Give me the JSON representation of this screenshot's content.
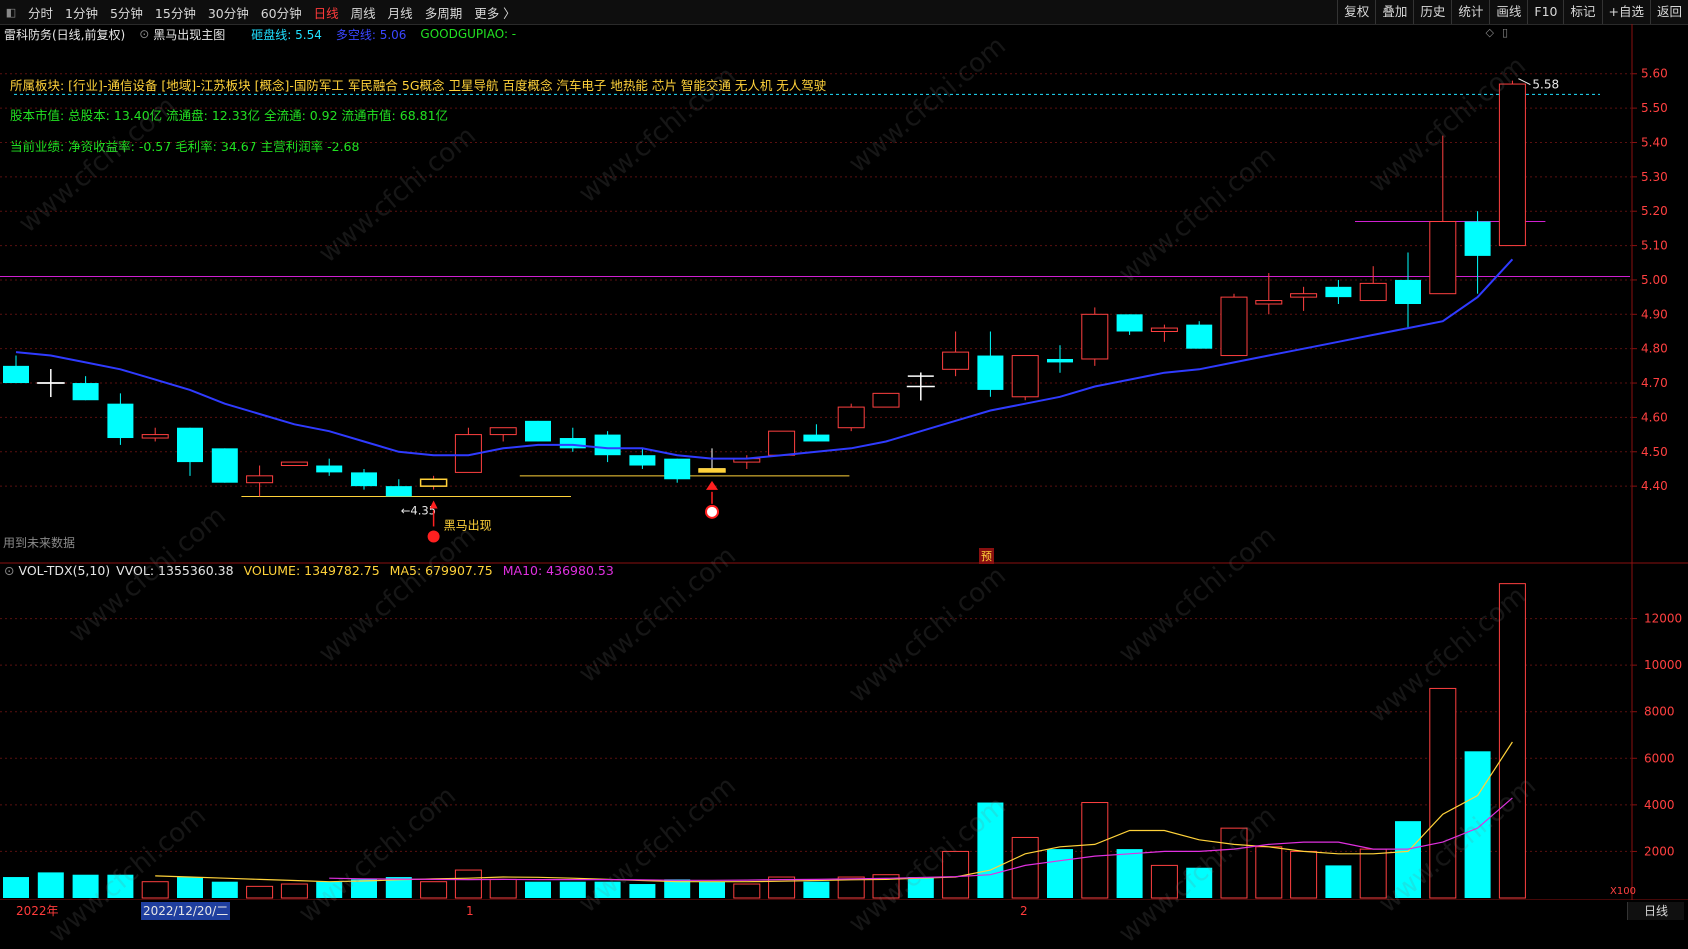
{
  "topbar": {
    "collapse_icon": "collapse-panel-icon",
    "periods": [
      "分时",
      "1分钟",
      "5分钟",
      "15分钟",
      "30分钟",
      "60分钟",
      "日线",
      "周线",
      "月线",
      "多周期",
      "更多 〉"
    ],
    "active_period": "日线",
    "tools": [
      "复权",
      "叠加",
      "历史",
      "统计",
      "画线",
      "F10",
      "标记",
      "+自选",
      "返回"
    ]
  },
  "info": {
    "stock_title": "雷科防务(日线,前复权)",
    "indicator_name": "黑马出现主图",
    "hard_line": "砸盘线: 5.54",
    "long_short": "多空线: 5.06",
    "goodgupiao": "GOODGUPIAO: -",
    "colors": {
      "hard": "#20e0ff",
      "longshort": "#2f3bff",
      "good": "#22e022"
    }
  },
  "info_lines": {
    "sectors": "所属板块: [行业]-通信设备 [地域]-江苏板块 [概念]-国防军工 军民融合 5G概念 卫星导航 百度概念 汽车电子 地热能 芯片 智能交通 无人机 无人驾驶",
    "market_cap": "股本市值: 总股本: 13.40亿 流通盘: 12.33亿 全流通: 0.92 流通市值: 68.81亿",
    "performance": "当前业绩: 净资收益率: -0.57 毛利率: 34.67 主营利润率 -2.68"
  },
  "annotations": {
    "low_label": "←4.35",
    "dark_horse": "黑马出现",
    "high_label": "5.58",
    "future_data": "用到未来数据",
    "yu": "预"
  },
  "volume_header": {
    "name": "VOL-TDX(5,10)",
    "vvol": "VVOL: 1355360.38",
    "volume": "VOLUME: 1349782.75",
    "ma5": "MA5: 679907.75",
    "ma10": "MA10: 436980.53",
    "unit": "X100"
  },
  "bottom": {
    "year": "2022年",
    "cursor_date": "2022/12/20/二",
    "month1": "1",
    "month2": "2",
    "period_label": "日线"
  },
  "watermark": "www.cfchi.com",
  "chart_data": [
    {
      "type": "candlestick",
      "title": "雷科防务(日线,前复权)",
      "y_ticks": [
        4.4,
        4.5,
        4.6,
        4.7,
        4.8,
        4.9,
        5.0,
        5.1,
        5.2,
        5.3,
        5.4,
        5.5,
        5.6
      ],
      "ylim": [
        4.22,
        5.64
      ],
      "candles": [
        {
          "o": 4.75,
          "h": 4.78,
          "l": 4.7,
          "c": 4.7,
          "v": 900
        },
        {
          "o": 4.7,
          "h": 4.71,
          "l": 4.7,
          "c": 4.7,
          "v": 1100,
          "cross": true
        },
        {
          "o": 4.7,
          "h": 4.72,
          "l": 4.65,
          "c": 4.65,
          "v": 1000
        },
        {
          "o": 4.64,
          "h": 4.67,
          "l": 4.52,
          "c": 4.54,
          "v": 1000
        },
        {
          "o": 4.54,
          "h": 4.57,
          "l": 4.53,
          "c": 4.55,
          "v": 700
        },
        {
          "o": 4.57,
          "h": 4.57,
          "l": 4.43,
          "c": 4.47,
          "v": 900
        },
        {
          "o": 4.51,
          "h": 4.51,
          "l": 4.41,
          "c": 4.41,
          "v": 700
        },
        {
          "o": 4.41,
          "h": 4.46,
          "l": 4.37,
          "c": 4.43,
          "v": 500
        },
        {
          "o": 4.46,
          "h": 4.47,
          "l": 4.46,
          "c": 4.47,
          "v": 600
        },
        {
          "o": 4.46,
          "h": 4.48,
          "l": 4.43,
          "c": 4.44,
          "v": 700
        },
        {
          "o": 4.44,
          "h": 4.45,
          "l": 4.39,
          "c": 4.4,
          "v": 800
        },
        {
          "o": 4.4,
          "h": 4.42,
          "l": 4.37,
          "c": 4.37,
          "v": 900
        },
        {
          "o": 4.4,
          "h": 4.43,
          "l": 4.39,
          "c": 4.42,
          "v": 700
        },
        {
          "o": 4.44,
          "h": 4.57,
          "l": 4.44,
          "c": 4.55,
          "v": 1200
        },
        {
          "o": 4.55,
          "h": 4.57,
          "l": 4.53,
          "c": 4.57,
          "v": 800
        },
        {
          "o": 4.59,
          "h": 4.59,
          "l": 4.53,
          "c": 4.53,
          "v": 700
        },
        {
          "o": 4.54,
          "h": 4.57,
          "l": 4.5,
          "c": 4.51,
          "v": 700
        },
        {
          "o": 4.55,
          "h": 4.56,
          "l": 4.47,
          "c": 4.49,
          "v": 700
        },
        {
          "o": 4.49,
          "h": 4.51,
          "l": 4.45,
          "c": 4.46,
          "v": 600
        },
        {
          "o": 4.48,
          "h": 4.48,
          "l": 4.41,
          "c": 4.42,
          "v": 800
        },
        {
          "o": 4.45,
          "h": 4.51,
          "l": 4.44,
          "c": 4.45,
          "v": 700
        },
        {
          "o": 4.47,
          "h": 4.49,
          "l": 4.45,
          "c": 4.48,
          "v": 600
        },
        {
          "o": 4.49,
          "h": 4.56,
          "l": 4.49,
          "c": 4.56,
          "v": 900
        },
        {
          "o": 4.55,
          "h": 4.58,
          "l": 4.53,
          "c": 4.53,
          "v": 700
        },
        {
          "o": 4.57,
          "h": 4.64,
          "l": 4.56,
          "c": 4.63,
          "v": 900
        },
        {
          "o": 4.63,
          "h": 4.67,
          "l": 4.63,
          "c": 4.67,
          "v": 1000
        },
        {
          "o": 4.72,
          "h": 4.72,
          "l": 4.72,
          "c": 4.72,
          "v": 900
        },
        {
          "o": 4.74,
          "h": 4.85,
          "l": 4.72,
          "c": 4.79,
          "v": 2000
        },
        {
          "o": 4.78,
          "h": 4.85,
          "l": 4.66,
          "c": 4.68,
          "v": 4100
        },
        {
          "o": 4.66,
          "h": 4.78,
          "l": 4.65,
          "c": 4.78,
          "v": 2600
        },
        {
          "o": 4.77,
          "h": 4.81,
          "l": 4.73,
          "c": 4.76,
          "v": 2100
        },
        {
          "o": 4.77,
          "h": 4.92,
          "l": 4.75,
          "c": 4.9,
          "v": 4100
        },
        {
          "o": 4.9,
          "h": 4.9,
          "l": 4.84,
          "c": 4.85,
          "v": 2100
        },
        {
          "o": 4.85,
          "h": 4.87,
          "l": 4.82,
          "c": 4.86,
          "v": 1400
        },
        {
          "o": 4.87,
          "h": 4.88,
          "l": 4.8,
          "c": 4.8,
          "v": 1300
        },
        {
          "o": 4.78,
          "h": 4.96,
          "l": 4.78,
          "c": 4.95,
          "v": 3000
        },
        {
          "o": 4.93,
          "h": 5.02,
          "l": 4.9,
          "c": 4.94,
          "v": 2200
        },
        {
          "o": 4.95,
          "h": 4.98,
          "l": 4.91,
          "c": 4.96,
          "v": 2000
        },
        {
          "o": 4.98,
          "h": 5.0,
          "l": 4.93,
          "c": 4.95,
          "v": 1400
        },
        {
          "o": 4.94,
          "h": 5.04,
          "l": 4.94,
          "c": 4.99,
          "v": 2100
        },
        {
          "o": 5.0,
          "h": 5.08,
          "l": 4.86,
          "c": 4.93,
          "v": 3300
        },
        {
          "o": 4.96,
          "h": 5.42,
          "l": 4.96,
          "c": 5.17,
          "v": 9000
        },
        {
          "o": 5.17,
          "h": 5.2,
          "l": 4.96,
          "c": 5.07,
          "v": 6300
        },
        {
          "o": 5.1,
          "h": 5.58,
          "l": 5.1,
          "c": 5.57,
          "v": 13500
        }
      ],
      "ma_line": [
        4.79,
        4.78,
        4.76,
        4.74,
        4.71,
        4.68,
        4.64,
        4.61,
        4.58,
        4.56,
        4.53,
        4.5,
        4.49,
        4.49,
        4.51,
        4.52,
        4.52,
        4.51,
        4.51,
        4.49,
        4.48,
        4.48,
        4.49,
        4.5,
        4.51,
        4.53,
        4.56,
        4.59,
        4.62,
        4.64,
        4.66,
        4.69,
        4.71,
        4.73,
        4.74,
        4.76,
        4.78,
        4.8,
        4.82,
        4.84,
        4.86,
        4.88,
        4.95,
        5.06
      ],
      "hlines": [
        {
          "value": 5.01,
          "color": "#d020d0"
        },
        {
          "value": 5.54,
          "color": "#20e0ff",
          "dashed": true
        }
      ],
      "support_lines": [
        {
          "from": 8,
          "to": 15,
          "value": 4.37
        },
        {
          "from": 16,
          "to": 23,
          "value": 4.43
        },
        {
          "from": 40,
          "to": 43,
          "value": 5.17
        }
      ],
      "legend": [
        "砸盘线",
        "多空线",
        "GOODGUPIAO"
      ]
    },
    {
      "type": "bar",
      "title": "VOL-TDX(5,10)",
      "y_ticks": [
        2000,
        4000,
        6000,
        8000,
        10000,
        12000
      ],
      "ylim": [
        0,
        14000
      ],
      "ma5": [
        null,
        null,
        null,
        null,
        950,
        900,
        850,
        800,
        750,
        700,
        730,
        780,
        820,
        850,
        900,
        890,
        850,
        800,
        750,
        700,
        700,
        700,
        720,
        750,
        780,
        800,
        850,
        900,
        1200,
        1900,
        2200,
        2300,
        2900,
        2900,
        2500,
        2300,
        2200,
        2000,
        1900,
        1900,
        2000,
        3600,
        4400,
        6700
      ],
      "ma10": [
        null,
        null,
        null,
        null,
        null,
        null,
        null,
        null,
        null,
        850,
        820,
        810,
        800,
        790,
        800,
        790,
        790,
        790,
        780,
        760,
        760,
        770,
        790,
        800,
        820,
        840,
        880,
        920,
        1000,
        1400,
        1600,
        1800,
        1900,
        2000,
        2000,
        2100,
        2300,
        2400,
        2400,
        2100,
        2100,
        2400,
        3000,
        4300
      ]
    }
  ]
}
